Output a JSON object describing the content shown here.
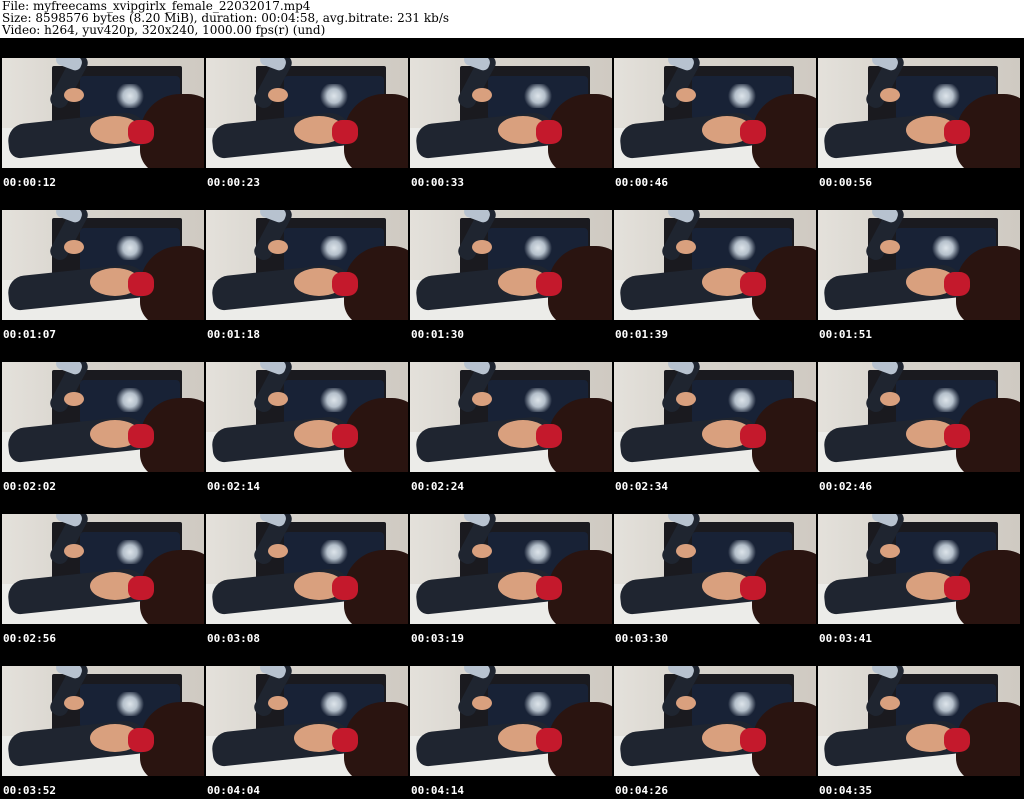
{
  "header": {
    "file_line": "File: myfreecams_xvipgirlx_female_22032017.mp4",
    "size_line": "Size: 8598576 bytes (8.20 MiB), duration: 00:04:58, avg.bitrate: 231 kb/s",
    "video_line": "Video: h264, yuv420p, 320x240, 1000.00 fps(r) (und)"
  },
  "thumbnails": [
    {
      "timestamp": "00:00:12"
    },
    {
      "timestamp": "00:00:23"
    },
    {
      "timestamp": "00:00:33"
    },
    {
      "timestamp": "00:00:46"
    },
    {
      "timestamp": "00:00:56"
    },
    {
      "timestamp": "00:01:07"
    },
    {
      "timestamp": "00:01:18"
    },
    {
      "timestamp": "00:01:30"
    },
    {
      "timestamp": "00:01:39"
    },
    {
      "timestamp": "00:01:51"
    },
    {
      "timestamp": "00:02:02"
    },
    {
      "timestamp": "00:02:14"
    },
    {
      "timestamp": "00:02:24"
    },
    {
      "timestamp": "00:02:34"
    },
    {
      "timestamp": "00:02:46"
    },
    {
      "timestamp": "00:02:56"
    },
    {
      "timestamp": "00:03:08"
    },
    {
      "timestamp": "00:03:19"
    },
    {
      "timestamp": "00:03:30"
    },
    {
      "timestamp": "00:03:41"
    },
    {
      "timestamp": "00:03:52"
    },
    {
      "timestamp": "00:04:04"
    },
    {
      "timestamp": "00:04:14"
    },
    {
      "timestamp": "00:04:26"
    },
    {
      "timestamp": "00:04:35"
    }
  ],
  "colors": {
    "background": "#000000",
    "header_background": "#ffffff",
    "timestamp_text": "#ffffff"
  }
}
